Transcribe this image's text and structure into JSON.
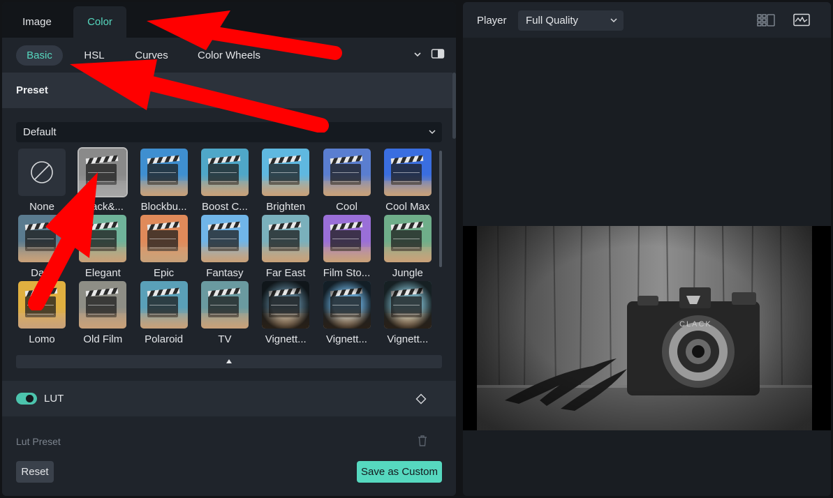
{
  "top_tabs": {
    "image": "Image",
    "color": "Color"
  },
  "sub_tabs": {
    "basic": "Basic",
    "hsl": "HSL",
    "curves": "Curves",
    "color_wheels": "Color Wheels"
  },
  "preset_section": {
    "title": "Preset",
    "dropdown_value": "Default"
  },
  "presets": [
    {
      "label": "None",
      "tint": "none"
    },
    {
      "label": "Black&...",
      "tint": "#8a8a8a",
      "selected": true
    },
    {
      "label": "Blockbu...",
      "tint": "#3f8fd0"
    },
    {
      "label": "Boost C...",
      "tint": "#4fa7c8"
    },
    {
      "label": "Brighten",
      "tint": "#5fb8e0"
    },
    {
      "label": "Cool",
      "tint": "#5a7ed0"
    },
    {
      "label": "Cool Max",
      "tint": "#3a6ee0"
    },
    {
      "label": "Dark",
      "tint": "#5a7b8f"
    },
    {
      "label": "Elegant",
      "tint": "#6fb39a"
    },
    {
      "label": "Epic",
      "tint": "#e08a5a"
    },
    {
      "label": "Fantasy",
      "tint": "#70b5e8"
    },
    {
      "label": "Far East",
      "tint": "#7ab0bc"
    },
    {
      "label": "Film Sto...",
      "tint": "#9a6fd8"
    },
    {
      "label": "Jungle",
      "tint": "#6fae8a"
    },
    {
      "label": "Lomo",
      "tint": "#e0b040"
    },
    {
      "label": "Old Film",
      "tint": "#8e8e86"
    },
    {
      "label": "Polaroid",
      "tint": "#5aa0b8"
    },
    {
      "label": "TV",
      "tint": "#6a9aa0"
    },
    {
      "label": "Vignett...",
      "tint": "#4e6e80"
    },
    {
      "label": "Vignett...",
      "tint": "#5e98c0"
    },
    {
      "label": "Vignett...",
      "tint": "#6ea0b0"
    }
  ],
  "lut": {
    "label": "LUT",
    "enabled": true,
    "preset_label": "Lut Preset"
  },
  "footer": {
    "reset": "Reset",
    "save_custom": "Save as Custom"
  },
  "player": {
    "label": "Player",
    "quality": "Full Quality"
  },
  "colors": {
    "accent": "#56d8bf",
    "annotation_arrow": "#ff0000"
  }
}
